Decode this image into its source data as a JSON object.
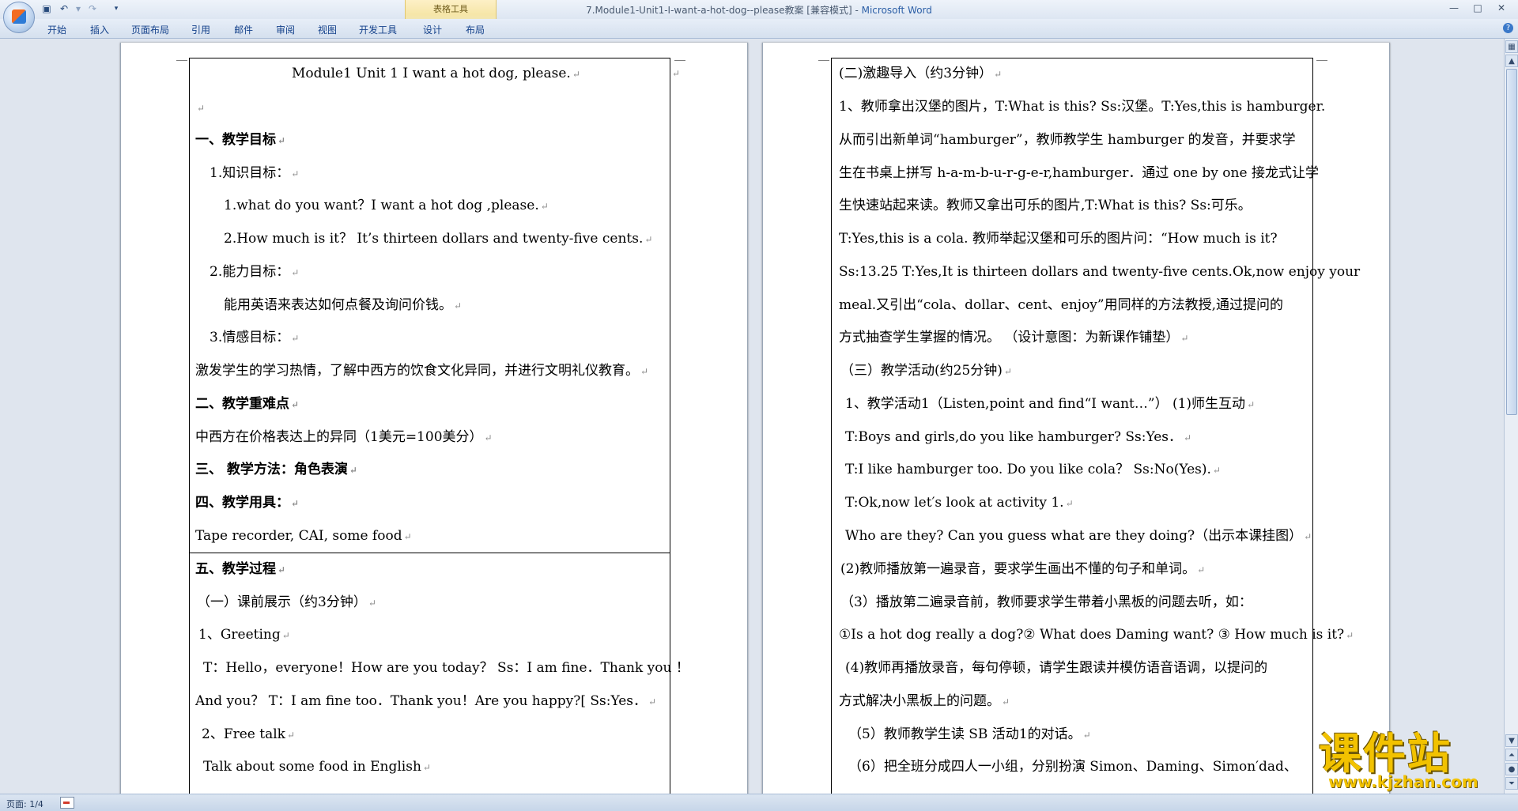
{
  "window": {
    "title": "7.Module1-Unit1-I-want-a-hot-dog--please教案 [兼容模式]",
    "separator": " - ",
    "app_name": "Microsoft Word",
    "context_tools_label": "表格工具"
  },
  "ribbon": {
    "tabs": [
      "开始",
      "插入",
      "页面布局",
      "引用",
      "邮件",
      "审阅",
      "视图",
      "开发工具",
      "设计",
      "布局"
    ]
  },
  "page1": {
    "title": "Module1    Unit 1 I want a hot dog, please.",
    "lines": [
      "一、教学目标",
      "1.知识目标：",
      "1.what do    you    want？I want    a    hot    dog    ,please.",
      "2.How much is it？     It’s thirteen dollars and twenty-five cents.",
      "2.能力目标：",
      "能用英语来表达如何点餐及询问价钱。",
      "3.情感目标：",
      "激发学生的学习热情，了解中西方的饮食文化异同，并进行文明礼仪教育。",
      "二、教学重难点",
      "中西方在价格表达上的异同（1美元=100美分）",
      "三、  教学方法：角色表演",
      "四、教学用具：",
      "Tape recorder, CAI, some food",
      "五、教学过程",
      "（一）课前展示（约3分钟）",
      "1、Greeting",
      "T：Hello，everyone！How are you today？   Ss：I am fine．Thank you ！",
      "And you？ T：I am fine too．Thank you！Are you happy?[ Ss:Yes．",
      "2、Free talk",
      "Talk about some food in English"
    ]
  },
  "page2": {
    "lines": [
      "(二)激趣导入（约3分钟）",
      "1、教师拿出汉堡的图片，T:What is this? Ss:汉堡。T:Yes,this is hamburger.",
      "从而引出新单词“hamburger”，教师教学生 hamburger 的发音，并要求学",
      "生在书桌上拼写 h-a-m-b-u-r-g-e-r,hamburger．通过 one by one 接龙式让学",
      "生快速站起来读。教师又拿出可乐的图片,T:What is this? Ss:可乐。",
      "T:Yes,this is a cola. 教师举起汉堡和可乐的图片问：“How much is it?",
      "Ss:13.25 T:Yes,It is thirteen dollars and twenty-five cents.Ok,now enjoy your",
      "meal.又引出“cola、dollar、cent、enjoy”用同样的方法教授,通过提问的",
      "方式抽查学生掌握的情况。  （设计意图：为新课作铺垫）",
      "（三）教学活动(约25分钟)",
      "1、教学活动1（Listen,point and find“I want…”） (1)师生互动",
      "T:Boys and girls,do you like hamburger?   Ss:Yes．",
      "T:I like hamburger too.   Do you like cola？  Ss:No(Yes).",
      "T:Ok,now let′s look at activity 1.",
      "Who are they? Can you guess what are they doing?（出示本课挂图）",
      "(2)教师播放第一遍录音，要求学生画出不懂的句子和单词。",
      "（3）播放第二遍录音前，教师要求学生带着小黑板的问题去听，如：",
      "①Is a hot dog really a dog?② What does Daming want? ③ How much is it?",
      "(4)教师再播放录音，每句停顿，请学生跟读并模仿语音语调，以提问的",
      "方式解决小黑板上的问题。",
      "（5）教师教学生读 SB 活动1的对话。",
      "（6）把全班分成四人一小组，分别扮演 Simon、Daming、Simon′dad、"
    ]
  },
  "status": {
    "page_info": "页面: 1/4"
  },
  "watermark": {
    "text": "课件站",
    "url": "www.kjzhan.com"
  },
  "colors": {
    "ribbon_text": "#15428b",
    "app_name": "#2b5ea6",
    "watermark": "#f2c200"
  }
}
